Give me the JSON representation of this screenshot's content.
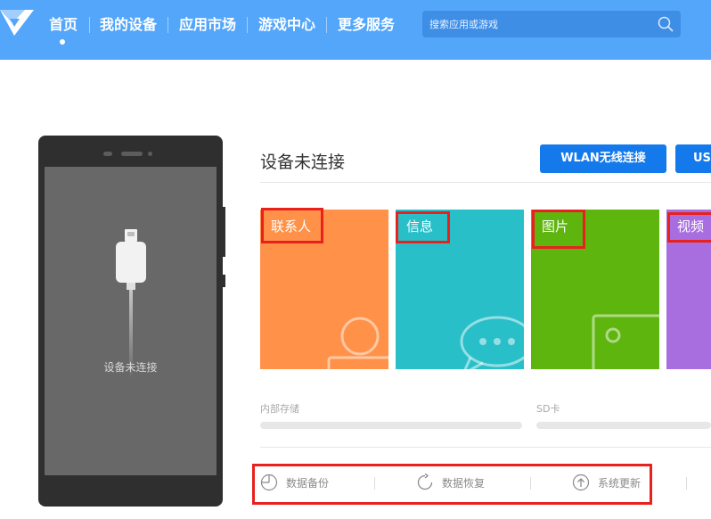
{
  "nav": {
    "items": [
      {
        "label": "首页",
        "active": true
      },
      {
        "label": "我的设备"
      },
      {
        "label": "应用市场"
      },
      {
        "label": "游戏中心"
      },
      {
        "label": "更多服务"
      }
    ]
  },
  "search": {
    "placeholder": "搜索应用或游戏",
    "icon": "search-icon"
  },
  "phone": {
    "status_text": "设备未连接"
  },
  "device": {
    "title": "设备未连接",
    "wlan_button": "WLAN无线连接",
    "usb_button": "USB连接"
  },
  "tiles": [
    {
      "label": "联系人",
      "color": "#ff9148",
      "icon": "contact-icon"
    },
    {
      "label": "信息",
      "color": "#29bfc8",
      "icon": "message-icon"
    },
    {
      "label": "图片",
      "color": "#5db50d",
      "icon": "picture-icon"
    },
    {
      "label": "视频",
      "color": "#a86ee0",
      "icon": "video-icon"
    }
  ],
  "storage": {
    "internal": {
      "label": "内部存储",
      "fill": 0
    },
    "sd": {
      "label": "SD卡",
      "fill": 0
    }
  },
  "actions": [
    {
      "label": "数据备份",
      "icon": "backup-icon"
    },
    {
      "label": "数据恢复",
      "icon": "restore-icon"
    },
    {
      "label": "系统更新",
      "icon": "update-icon"
    }
  ],
  "colors": {
    "header": "#54a6fa",
    "button": "#1479ea",
    "highlight_box": "#e8211d"
  }
}
